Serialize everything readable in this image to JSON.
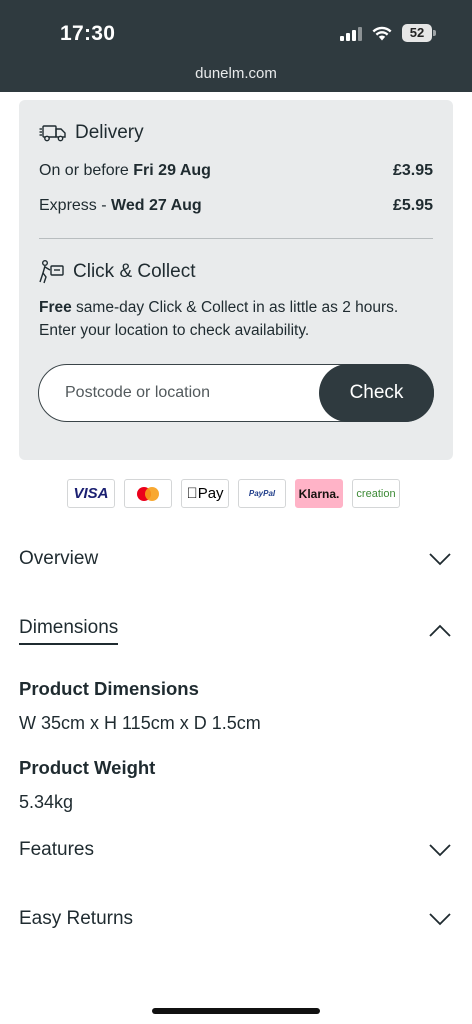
{
  "status_bar": {
    "time": "17:30",
    "battery": "52"
  },
  "browser": {
    "url": "dunelm.com"
  },
  "delivery": {
    "title": "Delivery",
    "standard": {
      "label_prefix": "On or before ",
      "date": "Fri 29 Aug",
      "price": "£3.95"
    },
    "express": {
      "label_prefix": "Express - ",
      "date": "Wed 27 Aug",
      "price": "£5.95"
    }
  },
  "click_collect": {
    "title": "Click & Collect",
    "free": "Free",
    "desc_rest": " same-day Click & Collect in as little as 2 hours. Enter your location to check availability.",
    "placeholder": "Postcode or location",
    "button": "Check"
  },
  "payments": [
    "VISA",
    "mastercard",
    "Pay",
    "PayPal",
    "Klarna.",
    "creation"
  ],
  "accordion": {
    "overview": "Overview",
    "dimensions": "Dimensions",
    "features": "Features",
    "returns": "Easy Returns"
  },
  "specs": {
    "dimensions_label": "Product Dimensions",
    "dimensions_value": "W 35cm x H 115cm x D 1.5cm",
    "weight_label": "Product Weight",
    "weight_value": "5.34kg"
  }
}
